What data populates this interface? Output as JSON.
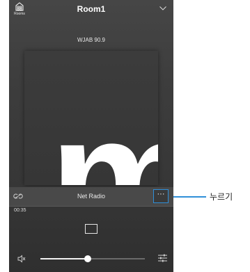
{
  "header": {
    "rooms_label": "Rooms",
    "rooms_icon": "house-rooms-icon",
    "room_name": "Room1",
    "dropdown_icon": "chevron-down-icon"
  },
  "now_playing": {
    "station": "WJAB 90.9",
    "artwork_letter": "m",
    "source": "Net Radio",
    "elapsed": "00:35",
    "progress": 0.0
  },
  "controls": {
    "link_icon": "link-icon",
    "more_label": "···",
    "stop_icon": "stop-icon",
    "mute_icon": "speaker-muted-icon",
    "volume": 0.45,
    "eq_icon": "sliders-icon"
  },
  "annotation": {
    "callout_text": "누르기",
    "accent_color": "#2f8fd8"
  }
}
